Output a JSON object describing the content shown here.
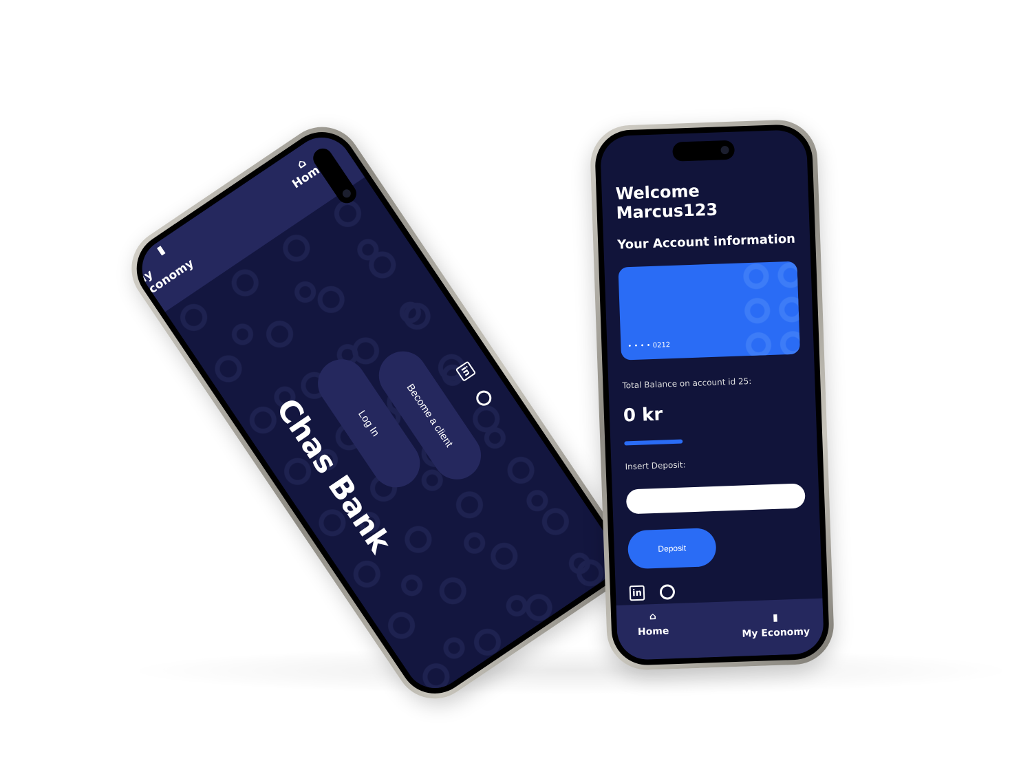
{
  "login_screen": {
    "title": "Chas Bank",
    "login_label": "Log In",
    "become_client_label": "Become a client",
    "nav": {
      "home": "Home",
      "economy": "My Economy"
    }
  },
  "account_screen": {
    "welcome": "Welcome Marcus123",
    "section_title": "Your Account information",
    "card_number": "• • • • 0212",
    "balance_label": "Total Balance on account id 25:",
    "balance": "0 kr",
    "deposit_label": "Insert Deposit:",
    "deposit_value": "",
    "deposit_button": "Deposit",
    "nav": {
      "home": "Home",
      "economy": "My Economy"
    }
  },
  "colors": {
    "background": "#11143a",
    "accent": "#2a6cf5",
    "nav": "#25285e"
  }
}
